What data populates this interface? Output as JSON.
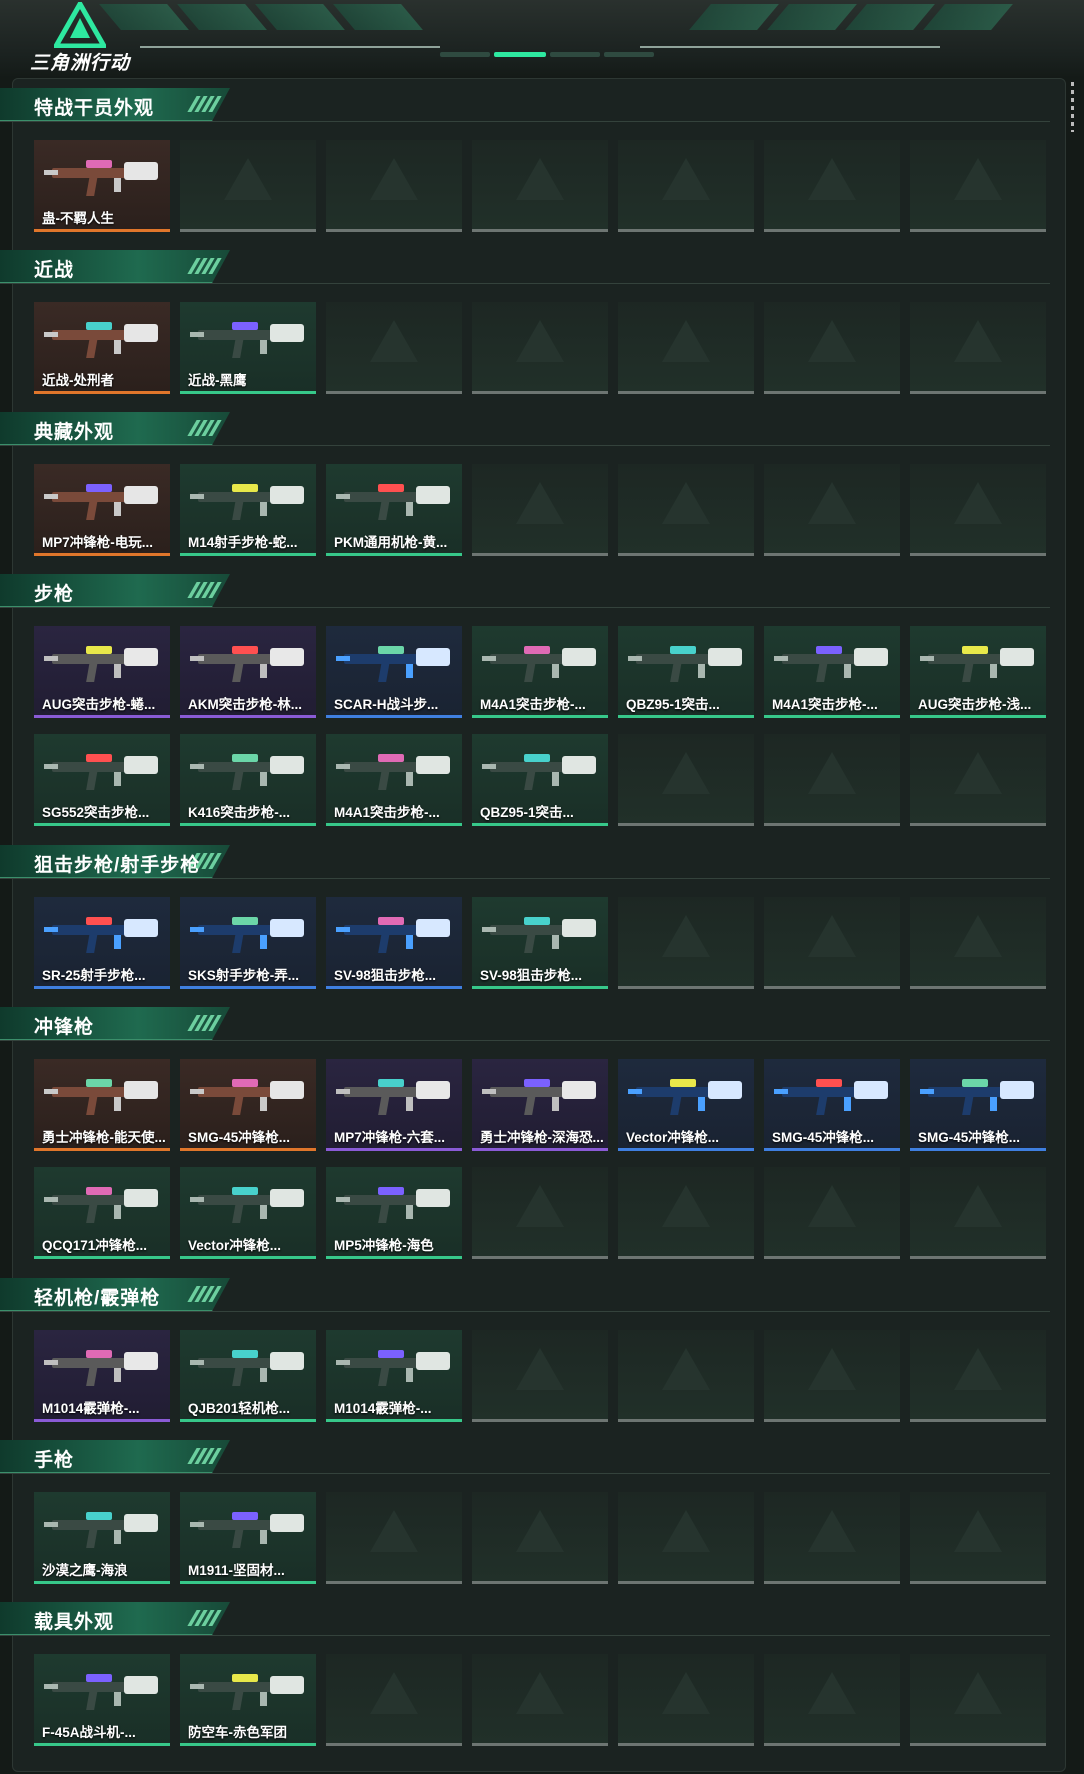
{
  "header": {
    "logo_text": "三角洲行动",
    "colors": {
      "accent": "#2ee8a0",
      "background": "#141a17"
    }
  },
  "sections": [
    {
      "title": "特战干员外观",
      "items": [
        {
          "label": "蛊-不羁人生",
          "quality": "orange"
        }
      ]
    },
    {
      "title": "近战",
      "items": [
        {
          "label": "近战-处刑者",
          "quality": "orange"
        },
        {
          "label": "近战-黑鹰",
          "quality": "green"
        }
      ]
    },
    {
      "title": "典藏外观",
      "items": [
        {
          "label": "MP7冲锋枪-电玩...",
          "quality": "orange"
        },
        {
          "label": "M14射手步枪-蛇...",
          "quality": "green"
        },
        {
          "label": "PKM通用机枪-黄...",
          "quality": "green"
        }
      ]
    },
    {
      "title": "步枪",
      "items": [
        {
          "label": "AUG突击步枪-蜷...",
          "quality": "purple"
        },
        {
          "label": "AKM突击步枪-林...",
          "quality": "purple"
        },
        {
          "label": "SCAR-H战斗步...",
          "quality": "blue"
        },
        {
          "label": "M4A1突击步枪-...",
          "quality": "green"
        },
        {
          "label": "QBZ95-1突击...",
          "quality": "green"
        },
        {
          "label": "M4A1突击步枪-...",
          "quality": "green"
        },
        {
          "label": "AUG突击步枪-浅...",
          "quality": "green"
        },
        {
          "label": "SG552突击步枪...",
          "quality": "green"
        },
        {
          "label": "K416突击步枪-...",
          "quality": "green"
        },
        {
          "label": "M4A1突击步枪-...",
          "quality": "green"
        },
        {
          "label": "QBZ95-1突击...",
          "quality": "green"
        }
      ]
    },
    {
      "title": "狙击步枪/射手步枪",
      "items": [
        {
          "label": "SR-25射手步枪...",
          "quality": "blue"
        },
        {
          "label": "SKS射手步枪-弄...",
          "quality": "blue"
        },
        {
          "label": "SV-98狙击步枪...",
          "quality": "blue"
        },
        {
          "label": "SV-98狙击步枪...",
          "quality": "green"
        }
      ]
    },
    {
      "title": "冲锋枪",
      "items": [
        {
          "label": "勇士冲锋枪-能天使...",
          "quality": "orange"
        },
        {
          "label": "SMG-45冲锋枪...",
          "quality": "orange"
        },
        {
          "label": "MP7冲锋枪-六套...",
          "quality": "purple"
        },
        {
          "label": "勇士冲锋枪-深海恐...",
          "quality": "purple"
        },
        {
          "label": "Vector冲锋枪...",
          "quality": "blue"
        },
        {
          "label": "SMG-45冲锋枪...",
          "quality": "blue"
        },
        {
          "label": "SMG-45冲锋枪...",
          "quality": "blue"
        },
        {
          "label": "QCQ171冲锋枪...",
          "quality": "green"
        },
        {
          "label": "Vector冲锋枪...",
          "quality": "green"
        },
        {
          "label": "MP5冲锋枪-海色",
          "quality": "green"
        }
      ]
    },
    {
      "title": "轻机枪/霰弹枪",
      "items": [
        {
          "label": "M1014霰弹枪-...",
          "quality": "purple"
        },
        {
          "label": "QJB201轻机枪...",
          "quality": "green"
        },
        {
          "label": "M1014霰弹枪-...",
          "quality": "green"
        }
      ]
    },
    {
      "title": "手枪",
      "items": [
        {
          "label": "沙漠之鹰-海浪",
          "quality": "green"
        },
        {
          "label": "M1911-坚固材...",
          "quality": "green"
        }
      ]
    },
    {
      "title": "载具外观",
      "items": [
        {
          "label": "F-45A战斗机-...",
          "quality": "green"
        },
        {
          "label": "防空车-赤色军团",
          "quality": "green"
        }
      ]
    }
  ]
}
